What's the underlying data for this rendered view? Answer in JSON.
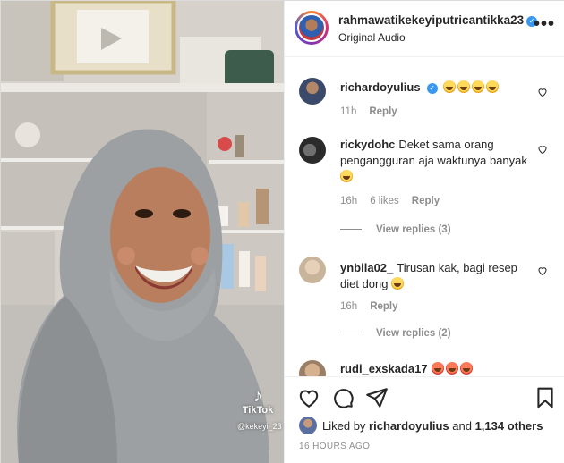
{
  "post": {
    "owner_username": "rahmawatikekeyiputricantikka23",
    "audio_label": "Original Audio",
    "more_label": "•••"
  },
  "media": {
    "watermark_logo": "♪",
    "watermark_brand": "TikTok",
    "watermark_handle": "@kekeyi_23"
  },
  "comments": [
    {
      "username": "richardoyulius",
      "verified": true,
      "text": "",
      "emoji_count": 4,
      "age": "11h",
      "likes": "",
      "reply_label": "Reply",
      "view_replies": ""
    },
    {
      "username": "rickydohc",
      "verified": false,
      "text": "Deket sama orang pengangguran aja waktunya banyak",
      "emoji_count": 1,
      "age": "16h",
      "likes": "6 likes",
      "reply_label": "Reply",
      "view_replies": "View replies (3)"
    },
    {
      "username": "ynbila02_",
      "verified": false,
      "text": "Tirusan kak, bagi resep diet dong",
      "emoji_count": 1,
      "age": "16h",
      "likes": "",
      "reply_label": "Reply",
      "view_replies": "View replies (2)"
    },
    {
      "username": "rudi_exskada17",
      "verified": false,
      "text": "",
      "emoji_count": 3,
      "age": "",
      "likes": "",
      "reply_label": "",
      "view_replies": ""
    }
  ],
  "likes": {
    "prefix": "Liked by",
    "user": "richardoyulius",
    "joiner": "and",
    "others": "1,134 others"
  },
  "timestamp": "16 HOURS AGO",
  "icons": {
    "like": "heart-icon",
    "comment": "comment-bubble-icon",
    "share": "paper-plane-icon",
    "save": "bookmark-icon",
    "verified": "verified-badge-icon",
    "more": "ellipsis-icon"
  },
  "colors": {
    "verified_badge": "#3897f0",
    "meta_text": "#8e8e8e",
    "text": "#262626"
  }
}
